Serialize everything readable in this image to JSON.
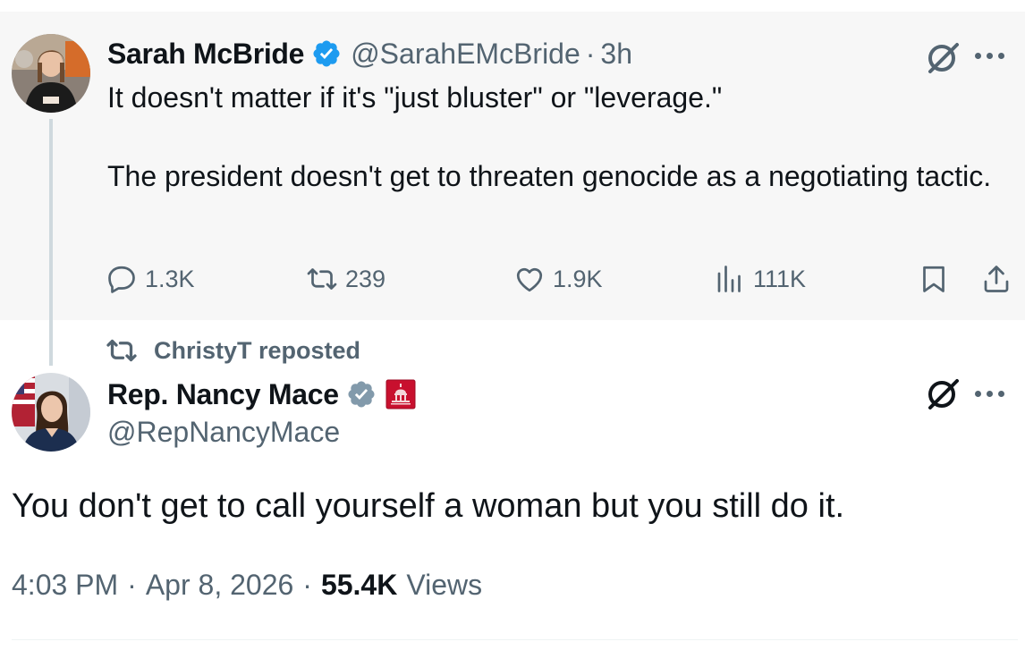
{
  "quoted_tweet": {
    "author_name": "Sarah McBride",
    "handle": "@SarahEMcBride",
    "time": "3h",
    "separator": "·",
    "text": "It doesn't matter if it's \"just bluster\" or \"leverage.\"\n\nThe president doesn't get to threaten genocide as a negotiating tactic.",
    "actions": {
      "replies": "1.3K",
      "reposts": "239",
      "likes": "1.9K",
      "views": "111K"
    },
    "icons": [
      "verified-badge-icon",
      "grok-icon",
      "more-icon",
      "reply-icon",
      "repost-icon",
      "like-icon",
      "views-icon",
      "bookmark-icon",
      "share-icon"
    ]
  },
  "repost_context": {
    "text": "ChristyT reposted"
  },
  "main_tweet": {
    "author_name": "Rep. Nancy Mace",
    "handle": "@RepNancyMace",
    "text": "You don't get to call yourself a woman but you still do it.",
    "time": "4:03 PM",
    "date": "Apr 8, 2026",
    "views_count": "55.4K",
    "views_label": "Views",
    "separator": "·",
    "icons": [
      "government-verified-badge-icon",
      "us-capitol-affiliate-icon",
      "grok-icon",
      "more-icon"
    ]
  },
  "colors": {
    "text_primary": "#0f1419",
    "text_secondary": "#536471",
    "verified_blue": "#1d9bf0",
    "verified_gray": "#829aab",
    "affiliate_red": "#c8102e",
    "quoted_background": "#f7f7f7"
  }
}
